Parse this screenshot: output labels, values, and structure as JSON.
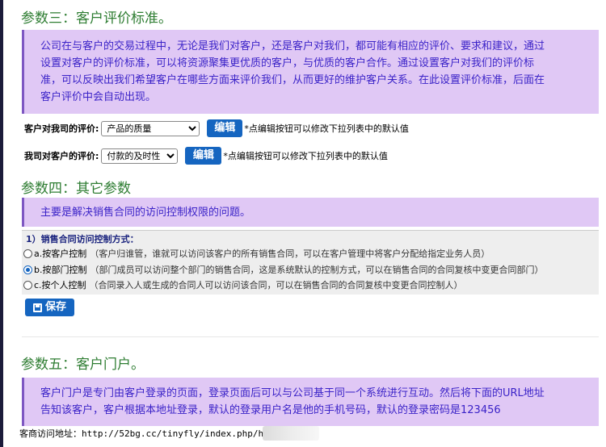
{
  "section3": {
    "title": "参数三：客户评价标准。",
    "desc_lines": [
      "公司在与客户的交易过程中，无论是我们对客户，还是客户对我们，都可能有相应的评价、要求和建议，通过",
      "设置对客户的评价标准，可以将资源聚集更优质的客户，与优质的客户合作。通过设置客户对我们的评价标",
      "准，可以反映出我们希望客户在哪些方面来评价我们，从而更好的维护客户关系。在此设置评价标准，后面在",
      "客户评价中会自动出现。"
    ],
    "customer_to_us": {
      "label": "客户对我司的评价:",
      "selected": "产品的质量",
      "button": "编辑",
      "hint": "*点编辑按钮可以修改下拉列表中的默认值"
    },
    "us_to_customer": {
      "label": "我司对客户的评价:",
      "selected": "付款的及时性",
      "button": "编辑",
      "hint": "*点编辑按钮可以修改下拉列表中的默认值"
    }
  },
  "section4": {
    "title": "参数四：其它参数",
    "desc": "主要是解决销售合同的访问控制权限的问题。",
    "control_title": "1）销售合同访问控制方式：",
    "options": [
      {
        "label": "a.按客户控制",
        "note": "（客户归谁管，谁就可以访问该客户的所有销售合同，可以在客户管理中将客户分配给指定业务人员）",
        "checked": false
      },
      {
        "label": "b.按部门控制",
        "note": "（部门成员可以访问整个部门的销售合同，这是系统默认的控制方式，可以在销售合同的合同复核中变更合同部门）",
        "checked": true
      },
      {
        "label": "c.按个人控制",
        "note": "（合同录入人或生成的合同人可以访问该合同，可以在销售合同的合同复核中变更合同控制人）",
        "checked": false
      }
    ],
    "save_label": "保存"
  },
  "section5": {
    "title": "参数五：客户门户。",
    "desc_lines": [
      "客户门户是专门由客户登录的页面，登录页面后可以与公司基于同一个系统进行互动。然后将下面的URL地址",
      "告知该客户，客户根据本地址登录，默认的登录用户名是他的手机号码，默认的登录密码是123456"
    ],
    "footer_text": "客商访问地址：http://52bg.cc/tinyfly/index.php/h"
  },
  "colors": {
    "title_green": "#2e7d32",
    "desc_bg": "#e0c8f5",
    "desc_text": "#3b23c8",
    "button_blue": "#1565c0"
  }
}
